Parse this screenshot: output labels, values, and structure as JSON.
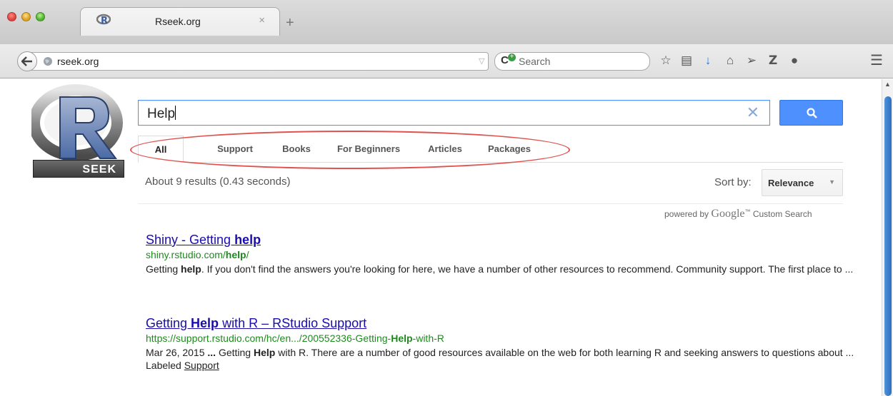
{
  "browser": {
    "tab_title": "Rseek.org",
    "url": "rseek.org",
    "search_placeholder": "Search",
    "new_tab_symbol": "+",
    "close_symbol": "×"
  },
  "logo": {
    "badge_text": "SEEK"
  },
  "query": {
    "value": "Help"
  },
  "tabs": [
    {
      "label": "All",
      "active": true
    },
    {
      "label": "Support"
    },
    {
      "label": "Books"
    },
    {
      "label": "For Beginners"
    },
    {
      "label": "Articles"
    },
    {
      "label": "Packages"
    }
  ],
  "results_info": {
    "stats": "About 9 results (0.43 seconds)",
    "sort_label": "Sort by:",
    "sort_value": "Relevance",
    "powered_prefix": "powered by",
    "powered_brand": "Google",
    "powered_tm": "™",
    "powered_suffix": "Custom Search"
  },
  "results": [
    {
      "title_pre": "Shiny - Getting ",
      "title_bold": "help",
      "title_post": "",
      "url_pre": "shiny.rstudio.com/",
      "url_bold": "help",
      "url_post": "/",
      "snippet_pre": "Getting ",
      "snippet_bold": "help",
      "snippet_post": ". If you don't find the answers you're looking for here, we have a number of other resources to recommend. Community support. The first place to ..."
    },
    {
      "title_pre": "Getting ",
      "title_bold": "Help",
      "title_post": " with R – RStudio Support",
      "url_pre": "https://support.rstudio.com/hc/en.../200552336-Getting-",
      "url_bold": "Help",
      "url_post": "-with-R",
      "date": "Mar 26, 2015",
      "ellipsis": " ... ",
      "snippet_pre": "Getting ",
      "snippet_bold": "Help",
      "snippet_post": " with R. There are a number of good resources available on the web for both learning R and seeking answers to questions about ...",
      "label_prefix": "Labeled",
      "label_link": "Support"
    }
  ],
  "colors": {
    "link": "#1a0dab",
    "url": "#1e8a1e",
    "search_button": "#4d90fe",
    "annotation": "#e0524f"
  },
  "icons": [
    "back-arrow-icon",
    "globe-icon",
    "reload-icon",
    "star-icon",
    "reader-icon",
    "download-icon",
    "home-icon",
    "send-icon",
    "zotero-icon",
    "chat-icon",
    "menu-icon",
    "clear-icon",
    "magnifier-icon"
  ]
}
